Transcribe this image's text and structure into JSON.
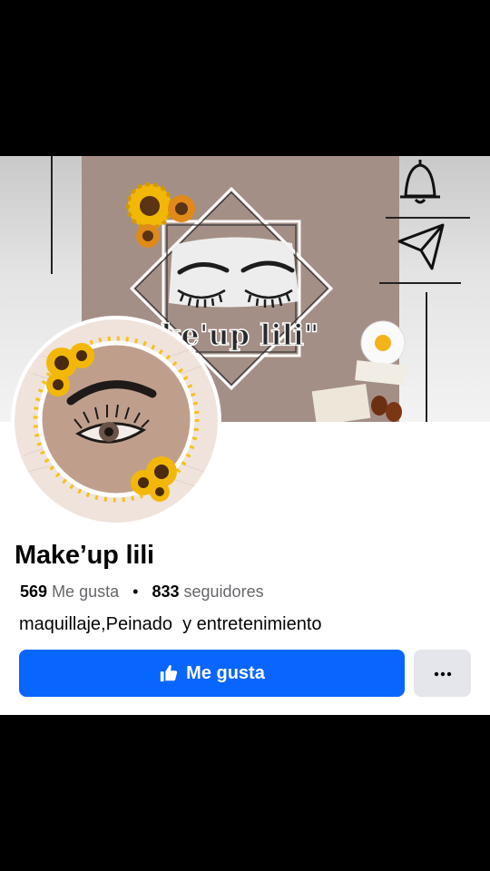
{
  "cover": {
    "banner_text": "ake'up lili\""
  },
  "profile": {
    "name": "Make’up lili",
    "likes_count": "569",
    "likes_label": "Me gusta",
    "separator": "•",
    "followers_count": "833",
    "followers_label": "seguidores",
    "category": "maquillaje,Peinado  y entretenimiento"
  },
  "actions": {
    "like_label": "Me gusta",
    "like_icon": "thumbs-up-icon",
    "more_icon": "more-horizontal-icon"
  },
  "colors": {
    "primary_button": "#0866ff",
    "secondary_button": "#e4e6eb",
    "text_primary": "#050505",
    "text_secondary": "#65676b"
  }
}
